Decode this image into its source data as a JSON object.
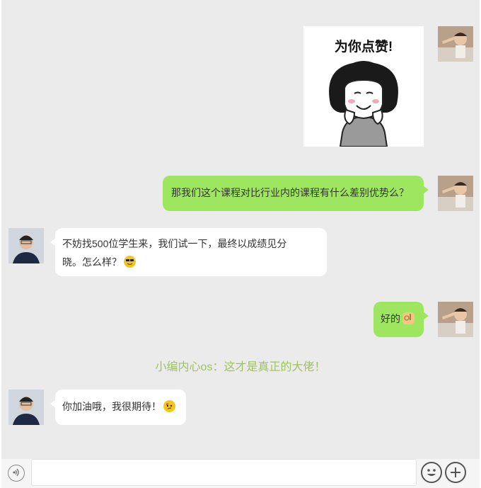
{
  "messages": [
    {
      "side": "right",
      "type": "sticker",
      "sticker_text": "为你点赞!"
    },
    {
      "side": "right",
      "type": "text",
      "text": "那我们这个课程对比行业内的课程有什么差别优势么？"
    },
    {
      "side": "left",
      "type": "text",
      "line1": "不妨找500位学生来，我们试一下，最终以成绩见分",
      "line2": "晓。怎么样？",
      "emoji": "sunglasses-emoji"
    },
    {
      "side": "right",
      "type": "text",
      "text": "好的",
      "emoji": "ok-hand-emoji"
    },
    {
      "side": "left",
      "type": "text",
      "text": "你加油哦，我很期待！",
      "emoji": "smirk-emoji"
    }
  ],
  "narration": "小编内心os：这才是真正的大佬！",
  "colors": {
    "my_bubble": "#9fe660",
    "their_bubble": "#ffffff",
    "background": "#ebebeb",
    "narration": "#9dc45f"
  },
  "input_bar": {
    "voice_icon": "voice-icon",
    "emoji_icon": "emoji-icon",
    "plus_icon": "plus-icon"
  }
}
